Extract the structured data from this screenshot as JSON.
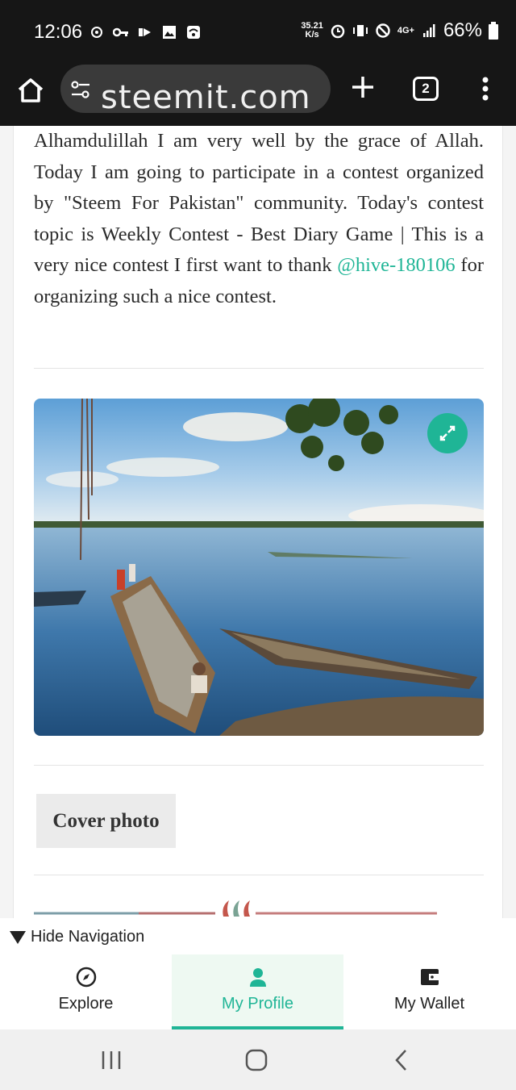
{
  "status_bar": {
    "time": "12:06",
    "net_speed_value": "35.21",
    "net_speed_unit": "K/s",
    "network_type": "4G+",
    "battery": "66%"
  },
  "browser": {
    "url_text": "steemit.com",
    "tab_count": "2"
  },
  "post": {
    "text_before_mention": "Alhamdulillah I am very well by the grace of Allah. Today I am going to participate in a contest organized by \"Steem For Pakistan\" community. Today's contest topic is Weekly Contest - Best Diary Game | This is a very nice contest I first want to thank ",
    "mention": "@hive-180106",
    "text_after_mention": " for organizing such a nice contest.",
    "cover_label": "Cover photo"
  },
  "nav": {
    "hide_label": "Hide Navigation",
    "items": [
      {
        "label": "Explore",
        "icon": "compass-icon"
      },
      {
        "label": "My Profile",
        "icon": "user-icon"
      },
      {
        "label": "My Wallet",
        "icon": "wallet-icon"
      }
    ],
    "active_index": 1
  },
  "colors": {
    "accent": "#1fb596",
    "dark_bar": "#161616",
    "text": "#2a2a2a"
  }
}
